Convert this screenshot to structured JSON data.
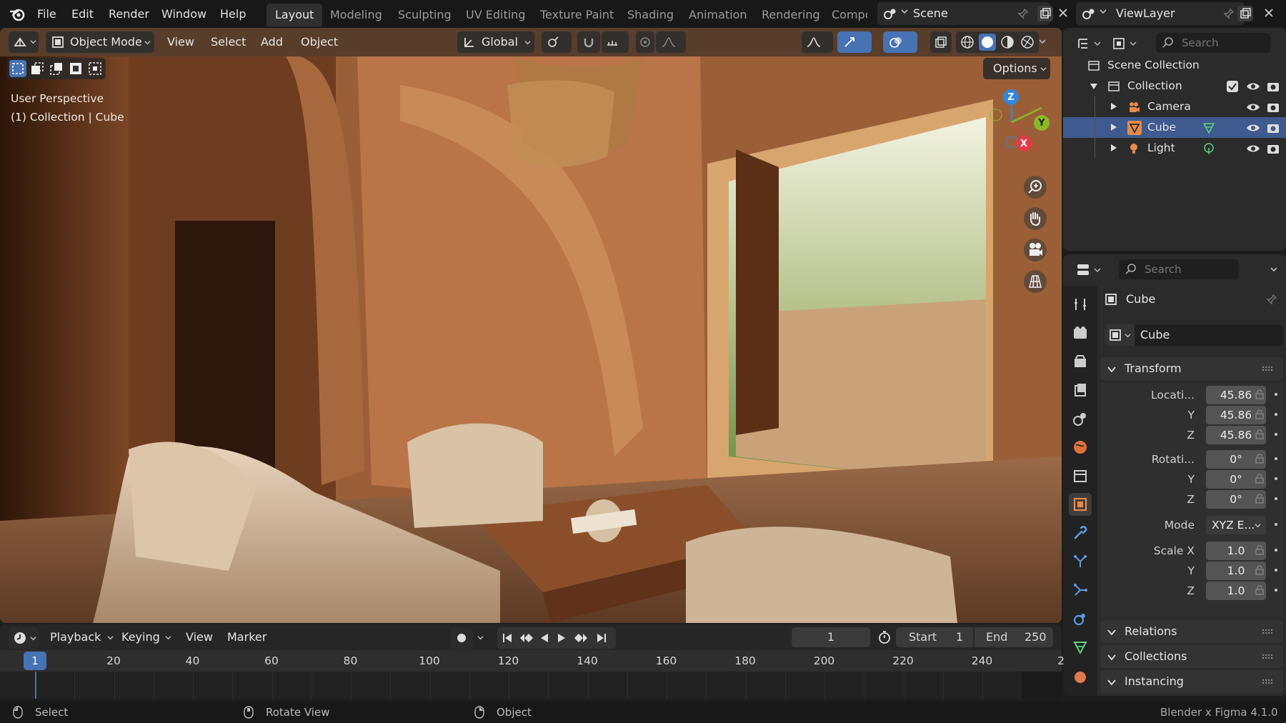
{
  "app": {
    "menus": [
      "File",
      "Edit",
      "Render",
      "Window",
      "Help"
    ],
    "workspace_tabs": [
      "Layout",
      "Modeling",
      "Sculpting",
      "UV Editing",
      "Texture Paint",
      "Shading",
      "Animation",
      "Rendering",
      "Compo"
    ],
    "active_workspace": "Layout",
    "scene_name": "Scene",
    "view_layer": "ViewLayer"
  },
  "viewport": {
    "mode": "Object Mode",
    "menus": [
      "View",
      "Select",
      "Add",
      "Object"
    ],
    "transform_orientation": "Global",
    "options_label": "Options",
    "overlay_line1": "User Perspective",
    "overlay_line2": "(1) Collection | Cube",
    "gizmo": {
      "z": "Z",
      "y": "Y",
      "x": "X"
    }
  },
  "outliner": {
    "search_placeholder": "Search",
    "root": "Scene Collection",
    "collection": "Collection",
    "items": [
      {
        "name": "Camera",
        "icon": "camera-icon",
        "selected": false
      },
      {
        "name": "Cube",
        "icon": "mesh-icon",
        "selected": true
      },
      {
        "name": "Light",
        "icon": "light-icon",
        "selected": false
      }
    ]
  },
  "properties": {
    "search_placeholder": "Search",
    "object_name": "Cube",
    "object_field": "Cube",
    "transform": {
      "title": "Transform",
      "location_label": "Locati...",
      "location": [
        "45.86",
        "45.86",
        "45.86"
      ],
      "rotation_label": "Rotati...",
      "rotation": [
        "0°",
        "0°",
        "0°"
      ],
      "mode_label": "Mode",
      "mode_value": "XYZ E...",
      "scale_label": "Scale X",
      "scale": [
        "1.0",
        "1.0",
        "1.0"
      ],
      "y": "Y",
      "z": "Z"
    },
    "panels": [
      "Relations",
      "Collections",
      "Instancing"
    ]
  },
  "timeline": {
    "menus": [
      "Playback",
      "Keying",
      "View",
      "Marker"
    ],
    "current_frame": "1",
    "start_label": "Start",
    "start": "1",
    "end_label": "End",
    "end": "250",
    "ticks": [
      "20",
      "40",
      "60",
      "80",
      "100",
      "120",
      "140",
      "160",
      "180",
      "200",
      "220",
      "240",
      "2"
    ],
    "playhead": "1"
  },
  "statusbar": {
    "select": "Select",
    "rotate": "Rotate View",
    "object": "Object",
    "version": "Blender x Figma 4.1.0"
  },
  "colors": {
    "accent": "#3f5a8f",
    "selection": "#4772b3",
    "x_axis": "#e23b48",
    "y_axis": "#8ab926",
    "z_axis": "#2f86e0"
  }
}
